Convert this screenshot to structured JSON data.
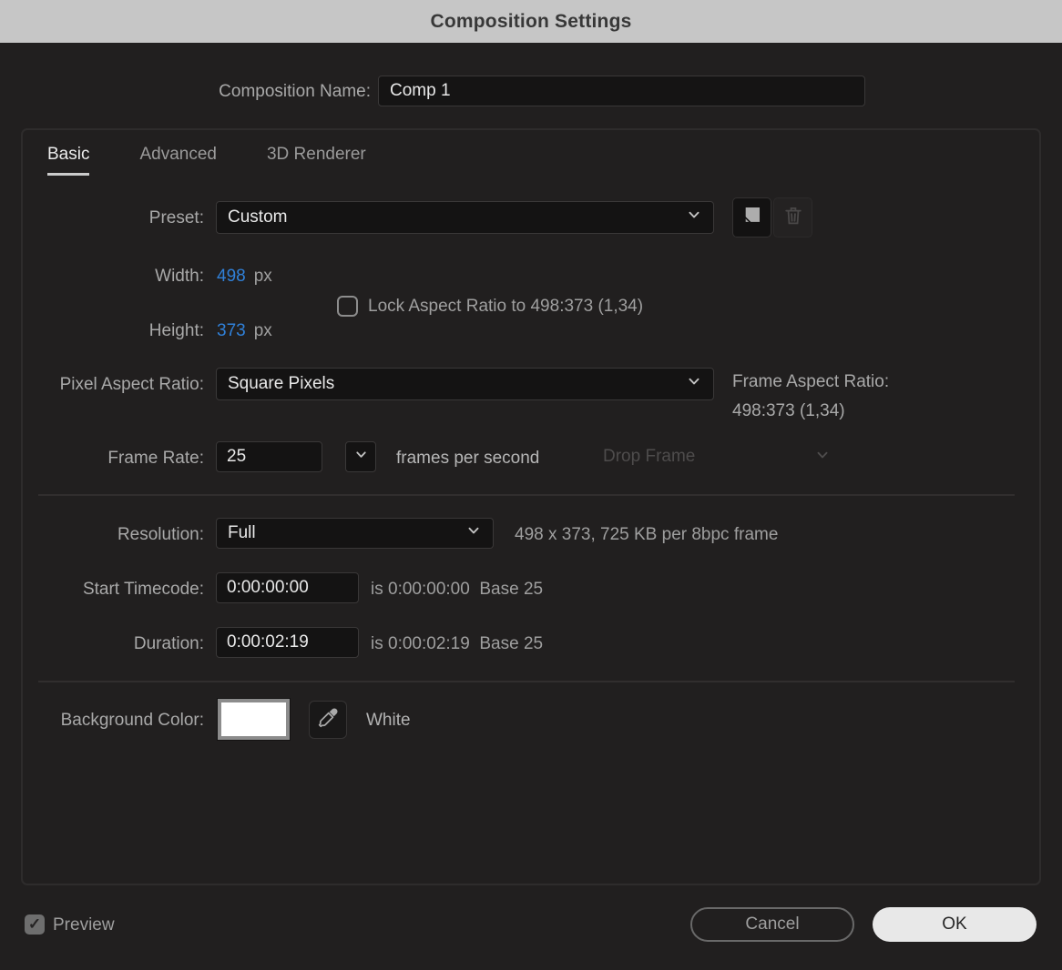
{
  "window": {
    "title": "Composition Settings"
  },
  "composition_name": {
    "label": "Composition Name:",
    "value": "Comp 1"
  },
  "tabs": [
    {
      "label": "Basic",
      "active": true
    },
    {
      "label": "Advanced",
      "active": false
    },
    {
      "label": "3D Renderer",
      "active": false
    }
  ],
  "preset": {
    "label": "Preset:",
    "value": "Custom"
  },
  "dimensions": {
    "width_label": "Width:",
    "width_value": "498",
    "width_unit": "px",
    "height_label": "Height:",
    "height_value": "373",
    "height_unit": "px",
    "lock_label": "Lock Aspect Ratio to 498:373 (1,34)",
    "lock_checked": false
  },
  "pixel_aspect_ratio": {
    "label": "Pixel Aspect Ratio:",
    "value": "Square Pixels"
  },
  "frame_aspect_ratio": {
    "label": "Frame Aspect Ratio:",
    "value": "498:373 (1,34)"
  },
  "frame_rate": {
    "label": "Frame Rate:",
    "value": "25",
    "suffix": "frames per second",
    "drop_frame_value": "Drop Frame",
    "drop_frame_enabled": false
  },
  "resolution": {
    "label": "Resolution:",
    "value": "Full",
    "info": "498 x 373, 725 KB per 8bpc frame"
  },
  "start_timecode": {
    "label": "Start Timecode:",
    "value": "0:00:00:00",
    "info": "is 0:00:00:00  Base 25"
  },
  "duration": {
    "label": "Duration:",
    "value": "0:00:02:19",
    "info": "is 0:00:02:19  Base 25"
  },
  "background_color": {
    "label": "Background Color:",
    "color_name": "White",
    "swatch_color": "#ffffff"
  },
  "footer": {
    "preview_label": "Preview",
    "preview_checked": true,
    "check_glyph": "✓",
    "cancel_label": "Cancel",
    "ok_label": "OK"
  },
  "colors": {
    "accent_blue": "#3080d8",
    "titlebar_bg": "#c6c6c6",
    "dialog_bg": "#211f1f",
    "field_bg": "#141313"
  }
}
